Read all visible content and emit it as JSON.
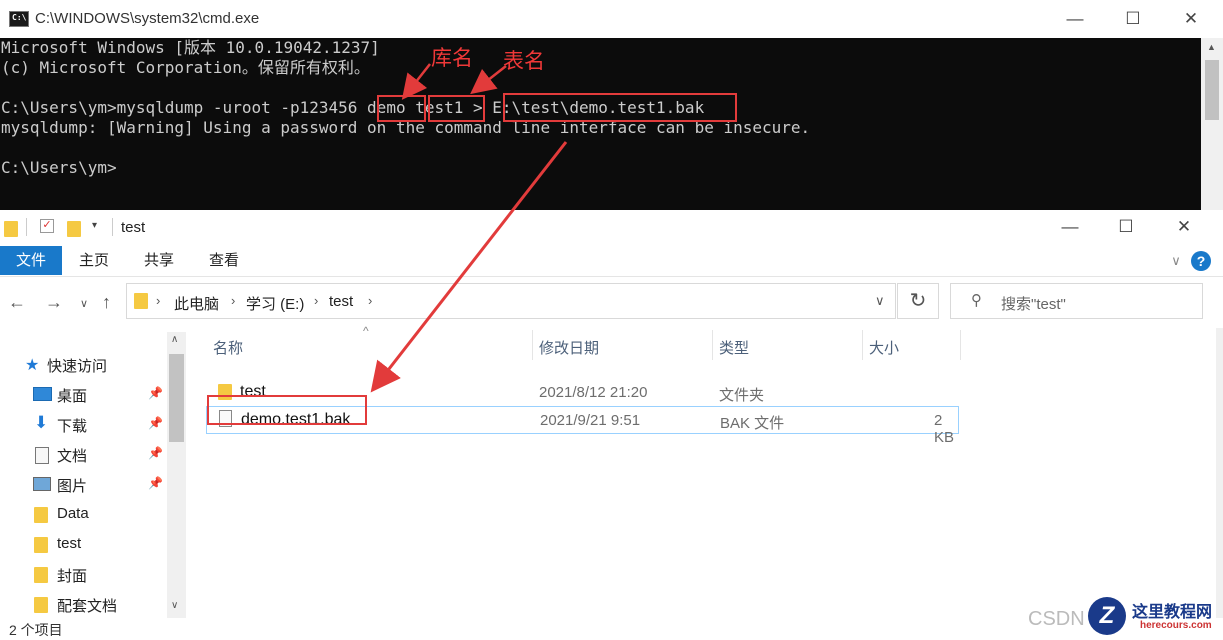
{
  "cmd": {
    "title": "C:\\WINDOWS\\system32\\cmd.exe",
    "lines": [
      "Microsoft Windows [版本 10.0.19042.1237]",
      "(c) Microsoft Corporation。保留所有权利。",
      "",
      "C:\\Users\\ym>mysqldump -uroot -p123456 demo test1 > E:\\test\\demo.test1.bak",
      "mysqldump: [Warning] Using a password on the command line interface can be insecure.",
      "",
      "C:\\Users\\ym>"
    ],
    "icon_text": "C:\\"
  },
  "annotations": {
    "db_label": "库名",
    "table_label": "表名"
  },
  "window_controls": {
    "minimize": "—",
    "maximize": "☐",
    "close": "✕"
  },
  "explorer": {
    "title": "test",
    "ribbon_tabs": [
      "文件",
      "主页",
      "共享",
      "查看"
    ],
    "breadcrumb": [
      "此电脑",
      "学习 (E:)",
      "test"
    ],
    "search_placeholder": "搜索\"test\"",
    "nav": {
      "quick_access": "快速访问",
      "items": [
        {
          "label": "桌面",
          "icon": "desktop-icon",
          "pinned": true
        },
        {
          "label": "下载",
          "icon": "download-icon",
          "pinned": true
        },
        {
          "label": "文档",
          "icon": "document-icon",
          "pinned": true
        },
        {
          "label": "图片",
          "icon": "pictures-icon",
          "pinned": true
        },
        {
          "label": "Data",
          "icon": "folder-icon",
          "pinned": false
        },
        {
          "label": "test",
          "icon": "folder-icon",
          "pinned": false
        },
        {
          "label": "封面",
          "icon": "folder-icon",
          "pinned": false
        },
        {
          "label": "配套文档",
          "icon": "folder-icon",
          "pinned": false
        }
      ]
    },
    "columns": [
      "名称",
      "修改日期",
      "类型",
      "大小"
    ],
    "files": [
      {
        "name": "test",
        "date": "2021/8/12 21:20",
        "type": "文件夹",
        "size": "",
        "icon": "folder-icon"
      },
      {
        "name": "demo.test1.bak",
        "date": "2021/9/21 9:51",
        "type": "BAK 文件",
        "size": "2 KB",
        "icon": "file-icon"
      }
    ],
    "status": "2 个项目"
  },
  "watermark": {
    "csdn": "CSDN",
    "site_name": "这里教程网",
    "site_url": "herecours.com"
  },
  "colors": {
    "accent": "#1979ca",
    "annotation": "#e23b3b"
  }
}
